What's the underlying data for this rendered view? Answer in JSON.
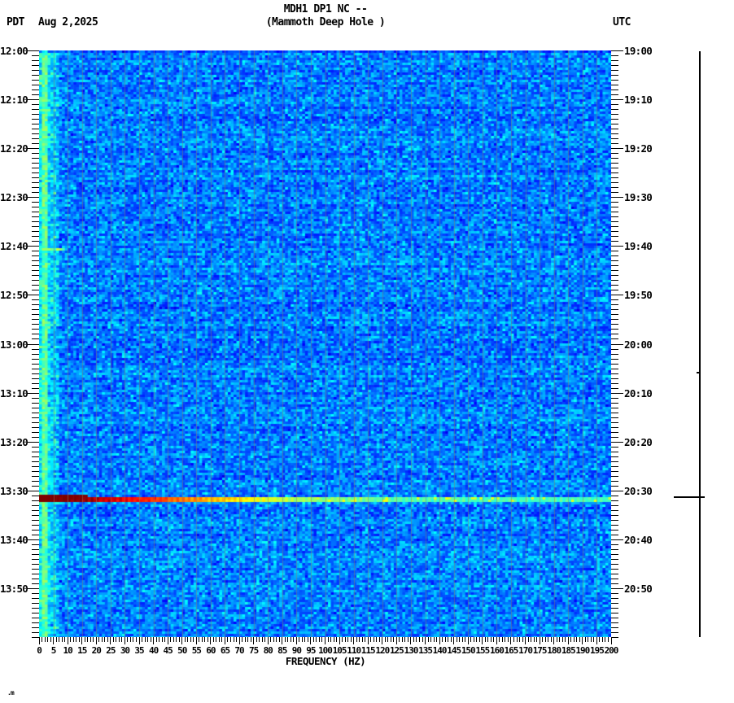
{
  "header": {
    "tz_left": "PDT",
    "date": "Aug 2,2025",
    "title_line1": "MDH1 DP1 NC --",
    "title_line2": "(Mammoth Deep Hole )",
    "tz_right": "UTC"
  },
  "watermark": ".m",
  "chart_data": {
    "type": "heatmap",
    "subtype": "seismic-spectrogram",
    "title": "MDH1 DP1 NC --",
    "subtitle": "(Mammoth Deep Hole )",
    "xlabel": "FREQUENCY (HZ)",
    "x_range_hz": [
      0,
      200
    ],
    "x_major_tick_step_hz": 5,
    "x_minor_tick_step_hz": 1,
    "x_tick_labels": [
      "0",
      "5",
      "10",
      "15",
      "20",
      "25",
      "30",
      "35",
      "40",
      "45",
      "50",
      "55",
      "60",
      "65",
      "70",
      "75",
      "80",
      "85",
      "90",
      "95",
      "100",
      "105",
      "110",
      "115",
      "120",
      "125",
      "130",
      "135",
      "140",
      "145",
      "150",
      "155",
      "160",
      "165",
      "170",
      "175",
      "180",
      "185",
      "190",
      "195",
      "200"
    ],
    "time_axis_left": {
      "timezone": "PDT",
      "date": "Aug 2,2025",
      "top": "12:00",
      "bottom": "14:00",
      "major_tick_step_min": 10,
      "minor_tick_step_min": 1,
      "tick_labels": [
        "12:00",
        "12:10",
        "12:20",
        "12:30",
        "12:40",
        "12:50",
        "13:00",
        "13:10",
        "13:20",
        "13:30",
        "13:40",
        "13:50"
      ]
    },
    "time_axis_right": {
      "timezone": "UTC",
      "top": "19:00",
      "bottom": "21:00",
      "major_tick_step_min": 10,
      "minor_tick_step_min": 1,
      "tick_labels": [
        "19:00",
        "19:10",
        "19:20",
        "19:30",
        "19:40",
        "19:50",
        "20:00",
        "20:10",
        "20:20",
        "20:30",
        "20:40",
        "20:50"
      ]
    },
    "colormap": "jet",
    "background_description": "blue random noise mosaic (quiet seismic background)",
    "background_colors": [
      "#0044dd",
      "#0077ee",
      "#0099ff",
      "#33bbff"
    ],
    "gridlines": {
      "vertical_every_hz": 5,
      "color": "#8c8270"
    },
    "features": [
      {
        "name": "broadband-event",
        "time_left_pdt": "13:31",
        "time_right_utc": "20:31",
        "freq_span_hz": [
          0,
          200
        ],
        "gradient_colors": [
          "#7f0000",
          "#cc0000",
          "#ff4400",
          "#ff9900",
          "#ffee44",
          "#ccff88",
          "#44ddff"
        ],
        "description": "strong broadband arrival: dark red at low frequency grading through orange and yellow to cyan at high frequency"
      },
      {
        "name": "low-frequency-band",
        "freq_span_hz": [
          0,
          7
        ],
        "description": "persistent brighter cyan band at lowest frequencies with thin bright green column near 1-2 Hz"
      },
      {
        "name": "minor-event",
        "time_left_pdt": "12:40",
        "time_right_utc": "19:40",
        "freq_span_hz": [
          0,
          9
        ],
        "description": "small bright cyan/green low-frequency burst"
      }
    ],
    "side_trace": {
      "description": "vertical amplitude trace line at far right, flat except event spike",
      "spike_time_utc": "20:31",
      "blip_time_utc": "20:06"
    }
  }
}
